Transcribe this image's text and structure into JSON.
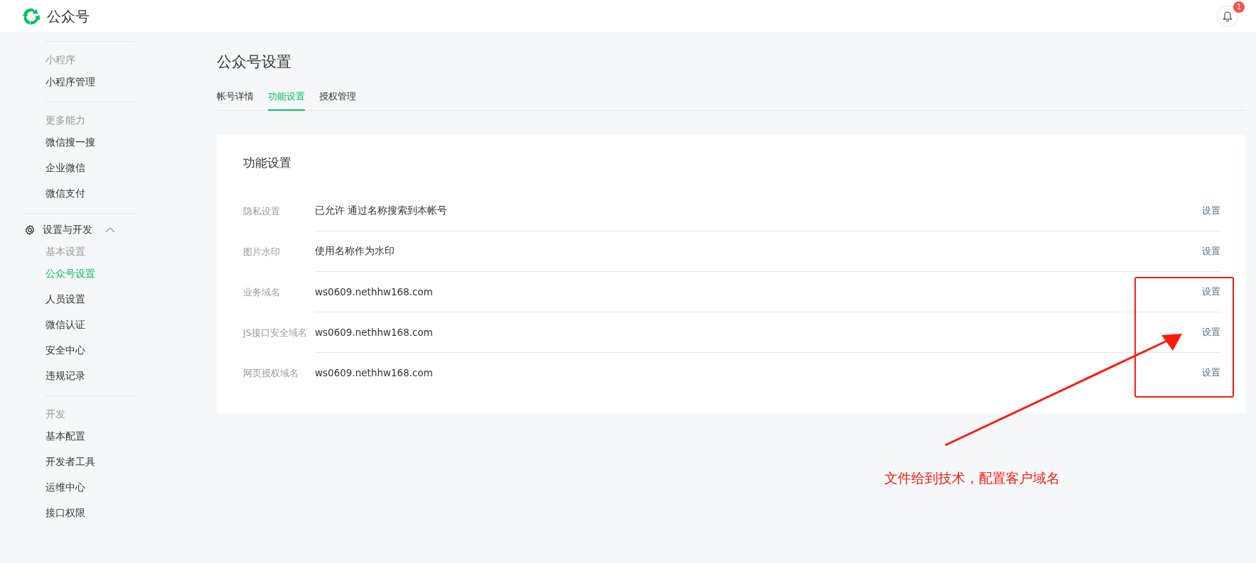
{
  "header": {
    "brand": "公众号",
    "notifications": "1"
  },
  "sidebar": {
    "groups": [
      {
        "kind": "section",
        "heading": "小程序",
        "items": [
          {
            "label": "小程序管理",
            "selected": false
          }
        ]
      },
      {
        "kind": "section",
        "heading": "更多能力",
        "items": [
          {
            "label": "微信搜一搜",
            "selected": false
          },
          {
            "label": "企业微信",
            "selected": false
          },
          {
            "label": "微信支付",
            "selected": false
          }
        ]
      },
      {
        "kind": "group",
        "label": "设置与开发",
        "expanded": true,
        "sections": [
          {
            "heading": "基本设置",
            "items": [
              {
                "label": "公众号设置",
                "selected": true
              },
              {
                "label": "人员设置",
                "selected": false
              },
              {
                "label": "微信认证",
                "selected": false
              },
              {
                "label": "安全中心",
                "selected": false
              },
              {
                "label": "违规记录",
                "selected": false
              }
            ]
          },
          {
            "heading": "开发",
            "items": [
              {
                "label": "基本配置",
                "selected": false
              },
              {
                "label": "开发者工具",
                "selected": false
              },
              {
                "label": "运维中心",
                "selected": false
              },
              {
                "label": "接口权限",
                "selected": false
              }
            ]
          }
        ]
      }
    ]
  },
  "page": {
    "title": "公众号设置",
    "tabs": [
      {
        "label": "帐号详情",
        "selected": false
      },
      {
        "label": "功能设置",
        "selected": true
      },
      {
        "label": "授权管理",
        "selected": false
      }
    ],
    "card": {
      "title": "功能设置",
      "rows": [
        {
          "label": "隐私设置",
          "value": "已允许 通过名称搜索到本帐号",
          "action": "设置"
        },
        {
          "label": "图片水印",
          "value": "使用名称作为水印",
          "action": "设置"
        },
        {
          "label": "业务域名",
          "value": "ws0609.nethhw168.com",
          "action": "设置"
        },
        {
          "label": "JS接口安全域名",
          "value": "ws0609.nethhw168.com",
          "action": "设置"
        },
        {
          "label": "网页授权域名",
          "value": "ws0609.nethhw168.com",
          "action": "设置"
        }
      ]
    }
  },
  "annotation": {
    "note": "文件给到技术，配置客户域名"
  }
}
